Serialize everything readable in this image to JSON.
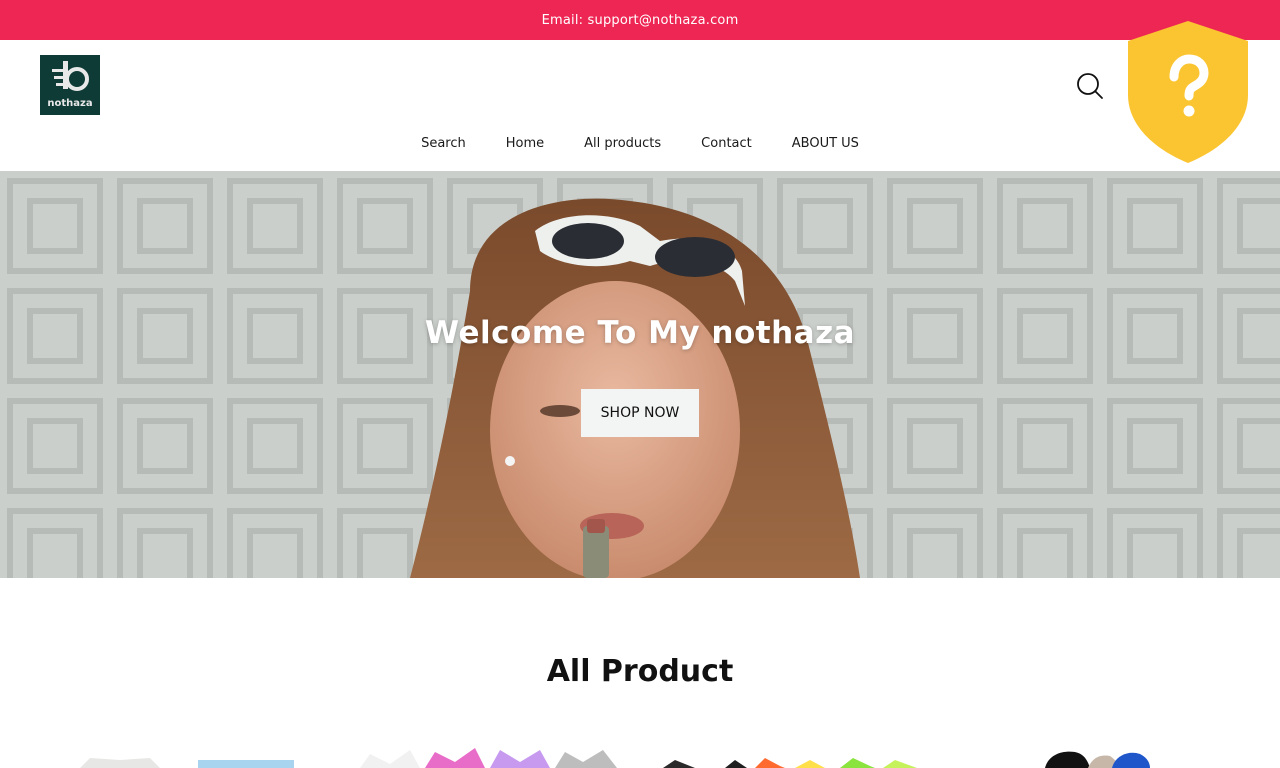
{
  "announcement": {
    "text": "Email: support@nothaza.com"
  },
  "brand": {
    "name": "nothaza",
    "logo_bg": "#0f3b36"
  },
  "header": {
    "search_icon": "search-icon"
  },
  "nav": [
    "Search",
    "Home",
    "All products",
    "Contact",
    "ABOUT US"
  ],
  "badge": {
    "icon": "question-shield-icon",
    "color": "#fbc531"
  },
  "hero": {
    "title": "Welcome To My nothaza",
    "button": "SHOP NOW"
  },
  "products": {
    "title": "All Product"
  },
  "colors": {
    "accent": "#ee2654",
    "hero_button_bg": "#f3f4f4"
  }
}
